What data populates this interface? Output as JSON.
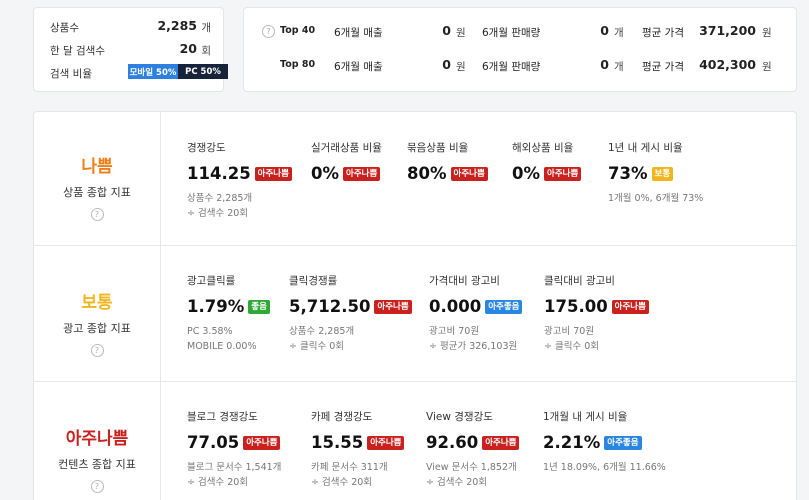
{
  "summary": {
    "product_count": {
      "label": "상품수",
      "value": "2,285",
      "unit": "개"
    },
    "monthly_search": {
      "label": "한 달 검색수",
      "value": "20",
      "unit": "회"
    },
    "search_ratio": {
      "label": "검색 비율",
      "mobile": "모바일 50%",
      "pc": "PC 50%",
      "mobile_fraction": 0.5
    }
  },
  "top_stats": {
    "help_icon": "?",
    "rows": [
      {
        "name": "Top 40",
        "sales_label": "6개월 매출",
        "sales_value": "0",
        "sales_unit": "원",
        "qty_label": "6개월 판매량",
        "qty_value": "0",
        "qty_unit": "개",
        "price_label": "평균 가격",
        "price_value": "371,200",
        "price_unit": "원"
      },
      {
        "name": "Top 80",
        "sales_label": "6개월 매출",
        "sales_value": "0",
        "sales_unit": "원",
        "qty_label": "6개월 판매량",
        "qty_value": "0",
        "qty_unit": "개",
        "price_label": "평균 가격",
        "price_value": "402,300",
        "price_unit": "원"
      }
    ]
  },
  "colors": {
    "bad": "#c9211e",
    "good": "#2fa836",
    "very_good": "#2a86e0",
    "normal": "#f2b51b",
    "grade_orange": "#f07f1a",
    "grade_yellow": "#f2b51b",
    "grade_red": "#c9211e"
  },
  "sections": [
    {
      "grade": "나쁨",
      "name": "상품 종합 지표",
      "help": "?",
      "metrics": [
        {
          "label": "경쟁강도",
          "value": "114.25",
          "badge": "아주나쁨",
          "sub1": "상품수 2,285개",
          "sub2": "÷ 검색수 20회"
        },
        {
          "label": "실거래상품 비율",
          "value": "0%",
          "badge": "아주나쁨",
          "sub1": "",
          "sub2": ""
        },
        {
          "label": "묶음상품 비율",
          "value": "80%",
          "badge": "아주나쁨",
          "sub1": "",
          "sub2": ""
        },
        {
          "label": "해외상품 비율",
          "value": "0%",
          "badge": "아주나쁨",
          "sub1": "",
          "sub2": ""
        },
        {
          "label": "1년 내 게시 비율",
          "value": "73%",
          "badge": "보통",
          "sub1": "1개월 0%, 6개월 73%",
          "sub2": ""
        }
      ]
    },
    {
      "grade": "보통",
      "name": "광고 종합 지표",
      "help": "?",
      "metrics": [
        {
          "label": "광고클릭률",
          "value": "1.79%",
          "badge": "좋음",
          "sub1": "PC 3.58%",
          "sub2": "MOBILE 0.00%"
        },
        {
          "label": "클릭경쟁률",
          "value": "5,712.50",
          "badge": "아주나쁨",
          "sub1": "상품수 2,285개",
          "sub2": "÷ 클릭수 0회"
        },
        {
          "label": "가격대비 광고비",
          "value": "0.000",
          "badge": "아주좋음",
          "sub1": "광고비 70원",
          "sub2": "÷ 평균가 326,103원"
        },
        {
          "label": "클릭대비 광고비",
          "value": "175.00",
          "badge": "아주나쁨",
          "sub1": "광고비 70원",
          "sub2": "÷ 클릭수 0회"
        }
      ]
    },
    {
      "grade": "아주나쁨",
      "name": "컨텐츠 종합 지표",
      "help": "?",
      "metrics": [
        {
          "label": "블로그 경쟁강도",
          "value": "77.05",
          "badge": "아주나쁨",
          "sub1": "블로그 문서수 1,541개",
          "sub2": "÷ 검색수 20회"
        },
        {
          "label": "카페 경쟁강도",
          "value": "15.55",
          "badge": "아주나쁨",
          "sub1": "카페 문서수 311개",
          "sub2": "÷ 검색수 20회"
        },
        {
          "label": "View 경쟁강도",
          "value": "92.60",
          "badge": "아주나쁨",
          "sub1": "View 문서수 1,852개",
          "sub2": "÷ 검색수 20회"
        },
        {
          "label": "1개월 내 게시 비율",
          "value": "2.21%",
          "badge": "아주좋음",
          "sub1": "1년 18.09%, 6개월 11.66%",
          "sub2": ""
        }
      ]
    }
  ]
}
